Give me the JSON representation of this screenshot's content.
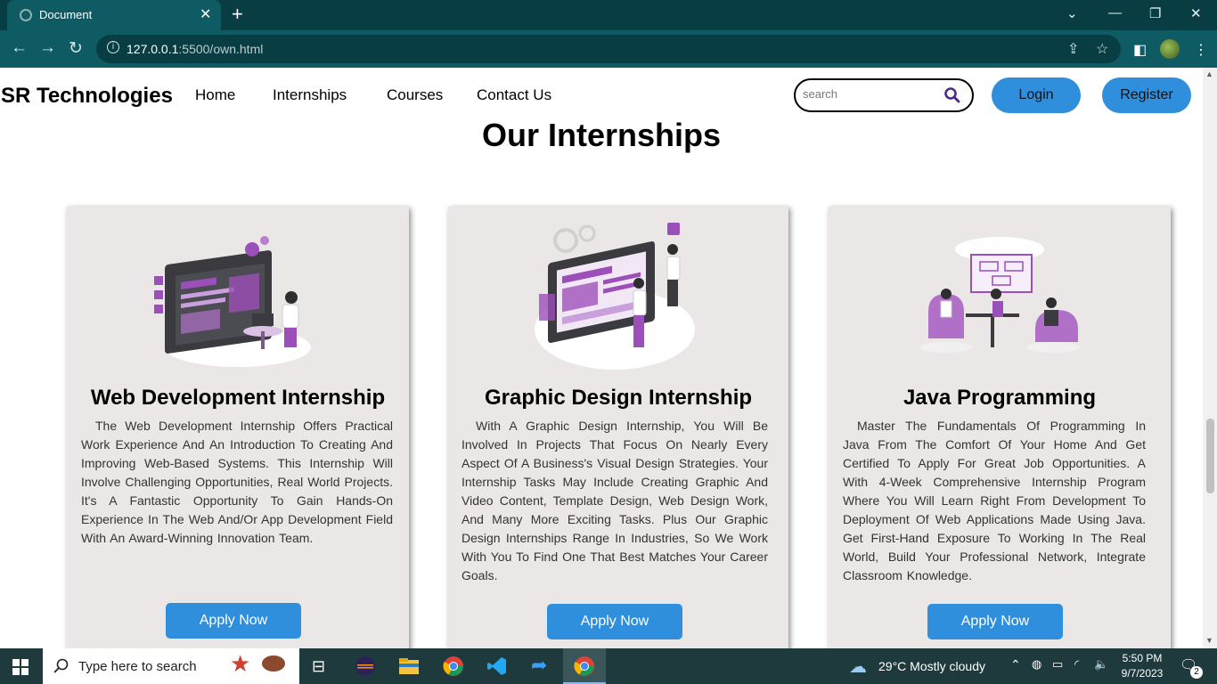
{
  "browser": {
    "tab_title": "Document",
    "url_host": "127.0.0.1",
    "url_rest": ":5500/own.html"
  },
  "nav": {
    "brand": "SR Technologies",
    "links": [
      "Home",
      "Internships",
      "Courses",
      "Contact Us"
    ],
    "search_placeholder": "search",
    "login_label": "Login",
    "register_label": "Register"
  },
  "main": {
    "heading": "Our Internships",
    "cards": [
      {
        "title": "Web Development Internship",
        "description": "The Web Development Internship Offers Practical Work Experience And An Introduction To Creating And Improving Web-Based Systems. This Internship Will Involve Challenging Opportunities, Real World Projects. It's A Fantastic Opportunity To Gain Hands-On Experience In The Web And/Or App Development Field With An Award-Winning Innovation Team.",
        "button": "Apply Now"
      },
      {
        "title": "Graphic Design Internship",
        "description": "With A Graphic Design Internship, You Will Be Involved In Projects That Focus On Nearly Every Aspect Of A Business's Visual Design Strategies. Your Internship Tasks May Include Creating Graphic And Video Content, Template Design, Web Design Work, And Many More Exciting Tasks. Plus Our Graphic Design Internships Range In Industries, So We Work With You To Find One That Best Matches Your Career Goals.",
        "button": "Apply Now"
      },
      {
        "title": "Java Programming",
        "description": "Master The Fundamentals Of Programming In Java From The Comfort Of Your Home And Get Certified To Apply For Great Job Opportunities. A With 4-Week Comprehensive Internship Program Where You Will Learn Right From Development To Deployment Of Web Applications Made Using Java. Get First-Hand Exposure To Working In The Real World, Build Your Professional Network, Integrate Classroom Knowledge.",
        "button": "Apply Now"
      }
    ]
  },
  "taskbar": {
    "search_text": "Type here to search",
    "weather": "29°C  Mostly cloudy",
    "time": "5:50 PM",
    "date": "9/7/2023",
    "notification_count": "2"
  },
  "colors": {
    "accent": "#2f8fdd",
    "illustration_purple": "#9b4fb8",
    "chrome_dark": "#083d44",
    "chrome_mid": "#0f5b63"
  }
}
